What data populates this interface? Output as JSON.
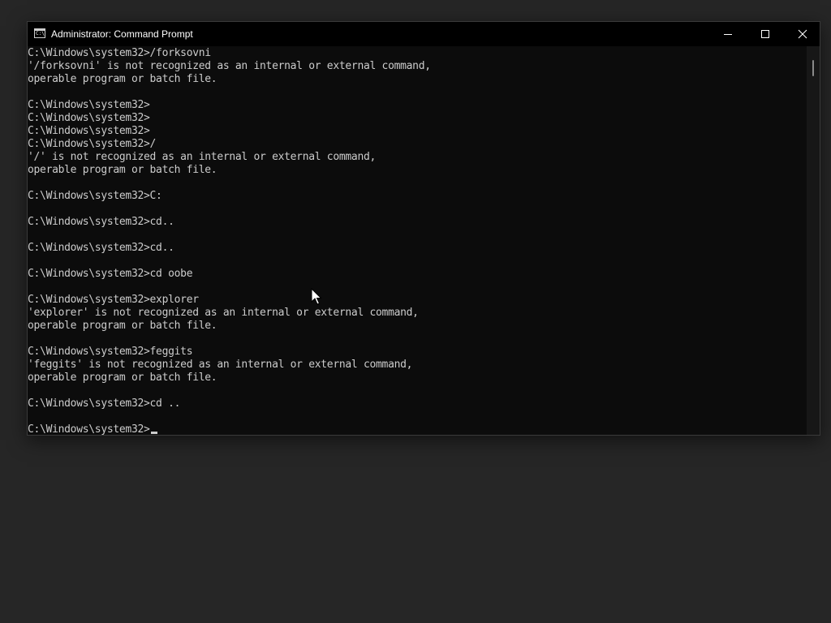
{
  "window": {
    "title": "Administrator: Command Prompt",
    "icon": "cmd-icon",
    "icon_glyph": "C:\\",
    "buttons": [
      "minimize-icon",
      "maximize-icon",
      "close-icon"
    ]
  },
  "console": {
    "lines": [
      "C:\\Windows\\system32>/forksovni",
      "'/forksovni' is not recognized as an internal or external command,",
      "operable program or batch file.",
      "",
      "C:\\Windows\\system32>",
      "C:\\Windows\\system32>",
      "C:\\Windows\\system32>",
      "C:\\Windows\\system32>/",
      "'/' is not recognized as an internal or external command,",
      "operable program or batch file.",
      "",
      "C:\\Windows\\system32>C:",
      "",
      "C:\\Windows\\system32>cd..",
      "",
      "C:\\Windows\\system32>cd..",
      "",
      "C:\\Windows\\system32>cd oobe",
      "",
      "C:\\Windows\\system32>explorer",
      "'explorer' is not recognized as an internal or external command,",
      "operable program or batch file.",
      "",
      "C:\\Windows\\system32>feggits",
      "'feggits' is not recognized as an internal or external command,",
      "operable program or batch file.",
      "",
      "C:\\Windows\\system32>cd ..",
      "",
      "C:\\Windows\\system32>"
    ]
  },
  "colors": {
    "console_background": "#0c0c0c",
    "console_text": "#cccccc",
    "titlebar": "#000000",
    "desktop": "#262626"
  }
}
